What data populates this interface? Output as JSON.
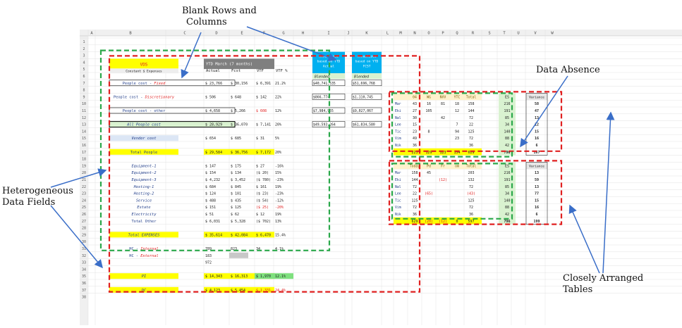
{
  "annotations": {
    "blank_rows_columns": [
      "Blank Rows and",
      "Columns"
    ],
    "data_absence": "Data Absence",
    "heterogeneous": [
      "Heterogeneous",
      "Data Fields"
    ],
    "closely_arranged": [
      "Closely Arranged",
      "Tables"
    ]
  },
  "columns": [
    "A",
    "B",
    "C",
    "D",
    "E",
    "F",
    "G",
    "H",
    "I",
    "J",
    "K",
    "L",
    "M",
    "N",
    "O",
    "P",
    "Q",
    "R",
    "S",
    "T",
    "U",
    "V",
    "W"
  ],
  "rows": [
    "1",
    "2",
    "3",
    "4",
    "5",
    "6",
    "7",
    "8",
    "9",
    "10",
    "11",
    "12",
    "13",
    "14",
    "15",
    "16",
    "17",
    "18",
    "19",
    "20",
    "21",
    "22",
    "23",
    "24",
    "25",
    "26",
    "27",
    "28",
    "29",
    "30",
    "31",
    "32",
    "33",
    "34",
    "35",
    "36",
    "37",
    "38"
  ],
  "main": {
    "vds": "VDS",
    "ytd": "YTD March (7 months)",
    "constant": "Constant $ Expenses",
    "hdr": [
      "Actual",
      "Fcst",
      "VTF",
      "VTF %"
    ],
    "ann1": [
      "Annualized",
      "based on YTD",
      "Actual"
    ],
    "ann2": [
      "Annualized",
      "based on YTD",
      "FCST"
    ],
    "blended": "Blended",
    "rows": [
      {
        "l": "People cost - ",
        "l2": "Fixed",
        "a": "$ 23,766",
        "f": "$ 30,156",
        "v": "$ 6,391",
        "p": "21.2%",
        "i": "$40,741,535",
        "k": "$51,696,768"
      },
      {
        "l": "People cost - ",
        "l2": "Discretionary",
        "a": "$ 506",
        "f": "$ 648",
        "v": "$ 142",
        "p": "22%",
        "i": "$866,774",
        "k": "$1,110,745"
      },
      {
        "l": "People cost - other",
        "a": "$ 4,658",
        "f": "$ 5,266",
        "v": "$ 608",
        "p": "12%",
        "i": "$7,984,955",
        "k": "$9,027,067"
      },
      {
        "l": "All People cost",
        "a": "$ 28,929",
        "f": "$ 36,070",
        "v": "$ 7,141",
        "p": "20%",
        "i": "$49,593,264",
        "k": "$61,834,580"
      },
      {
        "l": "Vendor cost",
        "a": "$ 654",
        "f": "$ 685",
        "v": "$ 31",
        "p": "5%"
      },
      {
        "l": "Total People",
        "a": "$ 29,584",
        "f": "$ 36,756",
        "v": "$ 7,172",
        "p": "20%"
      },
      {
        "l": "Equipment-1",
        "a": "$ 147",
        "f": "$ 175",
        "v": "$ 27",
        "p": "-16%"
      },
      {
        "l": "Equipment-2",
        "a": "$ 154",
        "f": "$ 134",
        "v": "($ 20)",
        "p": "15%"
      },
      {
        "l": "Equipment-3",
        "a": "$ 4,232",
        "f": "$ 3,452",
        "v": "($ 780)",
        "p": "-23%"
      },
      {
        "l": "Hosting-1",
        "a": "$ 684",
        "f": "$ 845",
        "v": "$ 161",
        "p": "19%"
      },
      {
        "l": "Hosting-2",
        "a": "$ 124",
        "f": "$ 101",
        "v": "($ 23)",
        "p": "-23%"
      },
      {
        "l": "Service",
        "a": "$ 488",
        "f": "$ 435",
        "v": "($ 54)",
        "p": "-12%"
      },
      {
        "l": "Estate",
        "a": "$ 151",
        "f": "$ 125",
        "v": "($ 25)",
        "p": "-20%"
      },
      {
        "l": "Electricity",
        "a": "$ 51",
        "f": "$ 62",
        "v": "$ 12",
        "p": "19%"
      },
      {
        "l": "Total Other",
        "a": "$ 6,031",
        "f": "$ 5,328",
        "v": "($ 702)",
        "p": "13%"
      },
      {
        "l": "Total EXPENSES",
        "a": "$ 35,614",
        "f": "$ 42,084",
        "v": "$ 6,470",
        "p": "15.4%"
      },
      {
        "l": "HC - ",
        "l2": "Internal",
        "a": "789",
        "f": "823",
        "v": "34",
        "p": "4.1%"
      },
      {
        "l": "HC - ",
        "l2": "External",
        "a": "183"
      },
      {
        "a": "972"
      },
      {
        "l": "PI",
        "a": "$ 14,343",
        "f": "$ 16,313",
        "v": "$ 1,970",
        "p": "12.1%"
      },
      {
        "l": "DC",
        "a": "$ 4,123",
        "f": "$ 5,454",
        "v": "$ 1,331",
        "p": "24.4%"
      }
    ]
  },
  "t1": {
    "hdr": [
      "04",
      "WG",
      "NVV",
      "YTC",
      "Total"
    ],
    "es": "ES",
    "names": [
      "Mar",
      "Eki",
      "Nal",
      "Lee",
      "Tic",
      "Vim",
      "Nik"
    ],
    "cells": [
      [
        "43",
        "16",
        "81",
        "18",
        "158"
      ],
      [
        "27",
        "105",
        "",
        "12",
        "144"
      ],
      [
        "30",
        "",
        "42",
        "",
        "72"
      ],
      [
        "15",
        "",
        "",
        "7",
        "22"
      ],
      [
        "23",
        "8",
        "",
        "94",
        "125"
      ],
      [
        "49",
        "",
        "",
        "23",
        "72"
      ],
      [
        "36",
        "",
        "",
        "",
        "36"
      ]
    ],
    "es_vals": [
      "216",
      "191",
      "85",
      "34",
      "140",
      "88",
      "42"
    ],
    "total": [
      "223",
      "129",
      "123",
      "154",
      "629"
    ],
    "es_total": "796",
    "variance": "Variance",
    "var_vals": [
      "58",
      "47",
      "13",
      "12",
      "15",
      "16",
      "6",
      "167"
    ]
  },
  "t2": {
    "hdr": [
      "Today",
      "Pd",
      "Fr",
      "om",
      "Total"
    ],
    "es": "ES",
    "names": [
      "Mar",
      "Eki",
      "Nal",
      "Lee",
      "Tic",
      "Vim",
      "Nik"
    ],
    "cells": [
      [
        "158",
        "45",
        "",
        "",
        "203"
      ],
      [
        "144",
        "",
        "(12)",
        "",
        "132"
      ],
      [
        "72",
        "",
        "",
        "",
        "72"
      ],
      [
        "22",
        "(65)",
        "",
        "",
        "(43)"
      ],
      [
        "125",
        "",
        "",
        "",
        "125"
      ],
      [
        "72",
        "",
        "",
        "",
        "72"
      ],
      [
        "36",
        "",
        "",
        "",
        "36"
      ]
    ],
    "es_vals": [
      "216",
      "191",
      "85",
      "34",
      "140",
      "88",
      "42"
    ],
    "total": [
      "629",
      "(20)",
      "(12)",
      "0",
      "597"
    ],
    "es_total": "796",
    "variance": "Variance",
    "var_vals": [
      "13",
      "59",
      "13",
      "77",
      "15",
      "16",
      "6",
      "199"
    ]
  },
  "colors": {
    "red": "#e02020",
    "green": "#2aa84a",
    "blue": "#3a6ec8",
    "yellow": "#ffff00",
    "cyan": "#00b0f0"
  }
}
